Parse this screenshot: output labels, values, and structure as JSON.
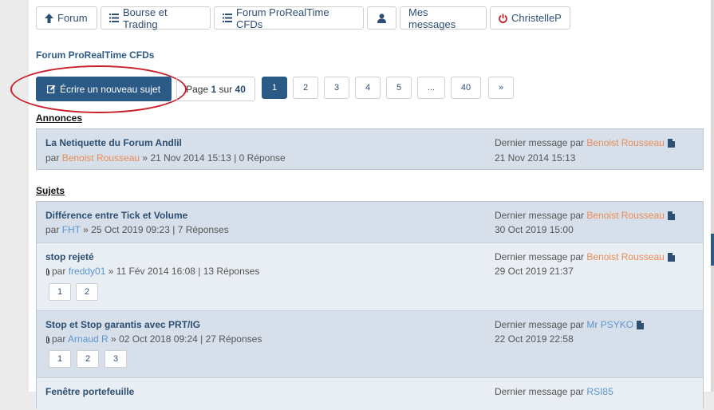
{
  "nav": {
    "items": [
      {
        "label": "Forum",
        "icon": "arrow-up-icon"
      },
      {
        "label": "Bourse et Trading",
        "icon": "list-icon"
      },
      {
        "label": "Forum ProRealTime CFDs",
        "icon": "list-icon"
      },
      {
        "label": "",
        "icon": "user-icon"
      },
      {
        "label": "Mes messages",
        "icon": ""
      },
      {
        "label": "ChristelleP",
        "icon": "power-icon"
      }
    ]
  },
  "breadcrumb": "Forum ProRealTime CFDs",
  "new_topic_label": "Écrire un nouveau sujet",
  "pageinfo": {
    "prefix": "Page",
    "current": "1",
    "mid": "sur",
    "total": "40"
  },
  "pagination": [
    "1",
    "2",
    "3",
    "4",
    "5",
    "...",
    "40",
    "»"
  ],
  "sections": {
    "annonces": "Annonces",
    "sujets": "Sujets"
  },
  "last_prefix": "Dernier message par",
  "by_prefix": "par",
  "annonces": [
    {
      "title": "La Netiquette du Forum Andlil",
      "author": "Benoist Rousseau",
      "date": "21 Nov 2014 15:13",
      "replies": "0 Réponse",
      "last_author": "Benoist Rousseau",
      "last_date": "21 Nov 2014 15:13"
    }
  ],
  "topics": [
    {
      "title": "Différence entre Tick et Volume",
      "author": "FHT",
      "date": "25 Oct 2019 09:23",
      "replies": "7 Réponses",
      "last_author": "Benoist Rousseau",
      "last_date": "30 Oct 2019 15:00",
      "pages": []
    },
    {
      "title": "stop rejeté",
      "author": "freddy01",
      "date": "11 Fév 2014 16:08",
      "replies": "13 Réponses",
      "last_author": "Benoist Rousseau",
      "last_date": "29 Oct 2019 21:37",
      "pages": [
        "1",
        "2"
      ]
    },
    {
      "title": "Stop et Stop garantis avec PRT/IG",
      "author": "Arnaud R",
      "date": "02 Oct 2018 09:24",
      "replies": "27 Réponses",
      "last_author": "Mr PSYKO",
      "last_date": "22 Oct 2019 22:58",
      "pages": [
        "1",
        "2",
        "3"
      ]
    },
    {
      "title": "Fenêtre portefeuille",
      "author": "",
      "date": "",
      "replies": "",
      "last_author": "RSI85",
      "last_date": "",
      "pages": []
    }
  ],
  "colors": {
    "primary": "#2b5a86",
    "author_orange": "#e98c56",
    "author_blue": "#5d94cf",
    "annotation": "#c8202a"
  }
}
